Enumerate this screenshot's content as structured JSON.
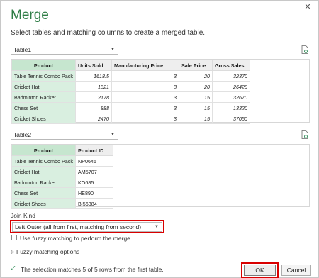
{
  "dialog": {
    "title": "Merge",
    "close_glyph": "✕",
    "subtitle": "Select tables and matching columns to create a merged table."
  },
  "table1": {
    "selected": "Table1",
    "headers": [
      "Product",
      "Units Sold",
      "Manufacturing Price",
      "Sale Price",
      "Gross Sales"
    ],
    "rows": [
      [
        "Table Tennis Combo Pack",
        "1618.5",
        "3",
        "20",
        "32370"
      ],
      [
        "Cricket Hat",
        "1321",
        "3",
        "20",
        "26420"
      ],
      [
        "Badminton Racket",
        "2178",
        "3",
        "15",
        "32670"
      ],
      [
        "Chess Set",
        "888",
        "3",
        "15",
        "13320"
      ],
      [
        "Cricket Shoes",
        "2470",
        "3",
        "15",
        "37050"
      ]
    ]
  },
  "table2": {
    "selected": "Table2",
    "headers": [
      "Product",
      "Product ID"
    ],
    "rows": [
      [
        "Table Tennis Combo Pack",
        "NP0645"
      ],
      [
        "Cricket Hat",
        "AM5707"
      ],
      [
        "Badminton Racket",
        "KO685"
      ],
      [
        "Chess Set",
        "HE890"
      ],
      [
        "Cricket Shoes",
        "BI56384"
      ]
    ]
  },
  "join": {
    "label": "Join Kind",
    "selected": "Left Outer (all from first, matching from second)",
    "fuzzy_checkbox_label": "Use fuzzy matching to perform the merge",
    "fuzzy_options_label": "Fuzzy matching options"
  },
  "status": {
    "text": "The selection matches 5 of 5 rows from the first table."
  },
  "buttons": {
    "ok": "OK",
    "cancel": "Cancel"
  },
  "colors": {
    "title_green": "#2e7d46",
    "highlight_red": "#d90000",
    "key_column": "#d9efe0"
  },
  "icons": {
    "dropdown": "chevron-down-icon",
    "file": "file-refresh-icon",
    "check": "check-icon",
    "expand": "chevron-right-icon",
    "close": "close-icon"
  }
}
